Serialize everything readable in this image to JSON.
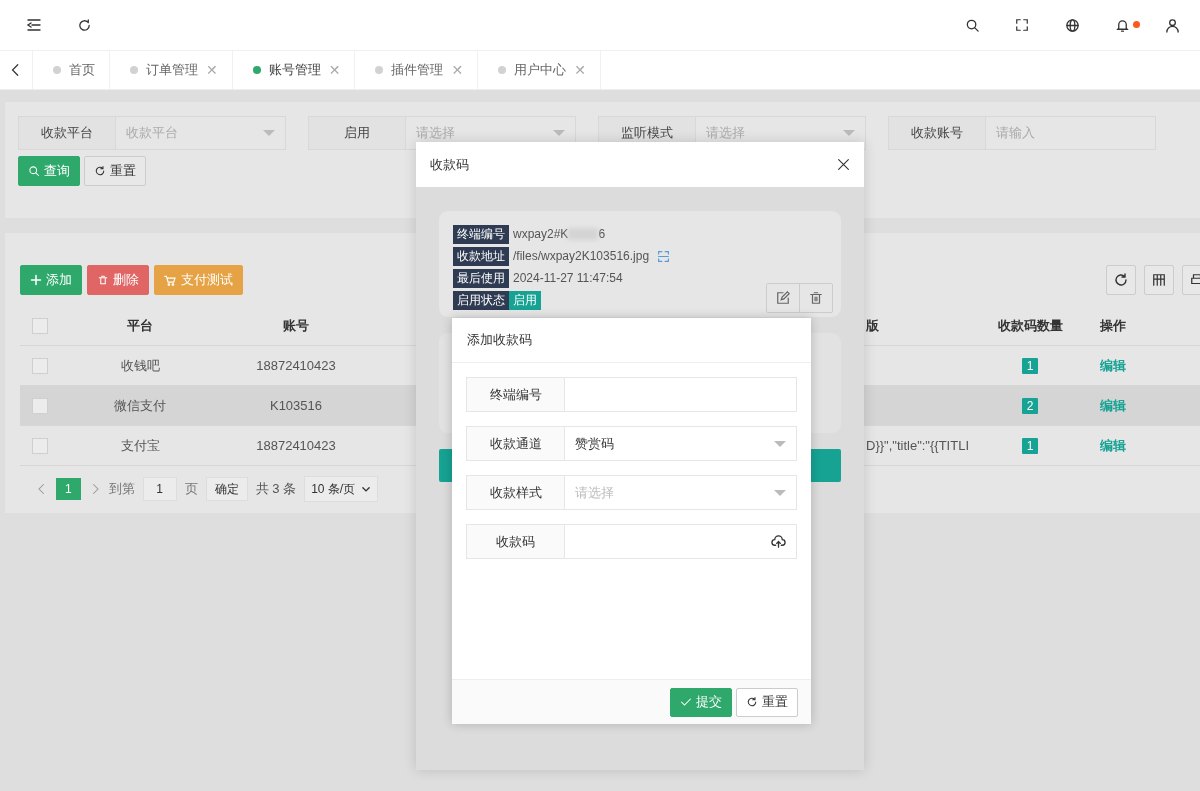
{
  "tabs": [
    {
      "label": "首页",
      "selected": false
    },
    {
      "label": "订单管理",
      "selected": false,
      "close": "✕"
    },
    {
      "label": "账号管理",
      "selected": true,
      "close": "✕"
    },
    {
      "label": "插件管理",
      "selected": false,
      "close": "✕"
    },
    {
      "label": "用户中心",
      "selected": false,
      "close": "✕"
    }
  ],
  "filters": [
    {
      "label": "收款平台",
      "kind": "select",
      "placeholder": "收款平台"
    },
    {
      "label": "启用",
      "kind": "select",
      "placeholder": "请选择"
    },
    {
      "label": "监听模式",
      "kind": "select",
      "placeholder": "请选择"
    },
    {
      "label": "收款账号",
      "kind": "input",
      "placeholder": "请输入"
    }
  ],
  "filter_buttons": [
    {
      "label": "查询",
      "kind": "search"
    },
    {
      "label": "重置",
      "kind": "reset"
    }
  ],
  "toolbar": [
    {
      "label": "添加",
      "kind": "add"
    },
    {
      "label": "删除",
      "kind": "delete"
    },
    {
      "label": "支付测试",
      "kind": "test"
    }
  ],
  "table": {
    "all_checked": false,
    "columns": [
      "平台",
      "账号",
      "版",
      "收款码数量",
      "操作"
    ],
    "rows": [
      {
        "checked": false,
        "highlighted": false,
        "platform": "收钱吧",
        "account": "18872410423",
        "count": "1",
        "action": "编辑"
      },
      {
        "checked": false,
        "highlighted": true,
        "platform": "微信支付",
        "account": "K103516",
        "count": "2",
        "action": "编辑"
      },
      {
        "checked": false,
        "highlighted": false,
        "platform": "支付宝",
        "account": "18872410423",
        "column_3": "D}}\",\"title\":\"{{TITLI",
        "count": "1",
        "action": "编辑"
      }
    ]
  },
  "pagination": {
    "current": "1",
    "goto_label": "到第",
    "goto_value": "1",
    "page_unit": "页",
    "confirm": "确定",
    "total": "共 3 条",
    "page_size": "10 条/页"
  },
  "dialog": {
    "title": "收款码",
    "fields": [
      {
        "label": "终端编号",
        "kind": "text",
        "value": "wxpay2#K",
        "redacted": true,
        "value_end": "6"
      },
      {
        "label": "收款地址",
        "kind": "path",
        "value": "/files/wxpay2K103516.jpg"
      },
      {
        "label": "最后使用",
        "kind": "text",
        "value": "2024-11-27 11:47:54"
      },
      {
        "label": "启用状态",
        "kind": "tag",
        "value": "启用"
      }
    ]
  },
  "form_dialog": {
    "title": "添加收款码",
    "fields": [
      {
        "label": "终端编号",
        "kind": "input"
      },
      {
        "label": "收款通道",
        "kind": "select",
        "value": "赞赏码"
      },
      {
        "label": "收款样式",
        "kind": "select",
        "placeholder": "请选择"
      },
      {
        "label": "收款码",
        "kind": "upload"
      }
    ],
    "buttons": [
      {
        "label": "提交",
        "kind": "submit"
      },
      {
        "label": "重置",
        "kind": "reset"
      }
    ]
  }
}
